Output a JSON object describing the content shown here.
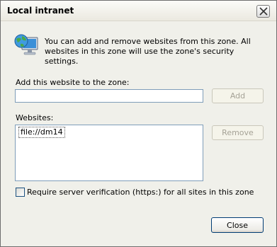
{
  "window": {
    "title": "Local intranet"
  },
  "info": {
    "icon": "intranet-computer-globe-icon",
    "text": "You can add and remove websites from this zone. All websites in this zone will use the zone's security settings."
  },
  "add_section": {
    "label": "Add this website to the zone:",
    "input_value": "",
    "add_button": "Add"
  },
  "websites_section": {
    "label": "Websites:",
    "items": [
      "file://dm14"
    ],
    "remove_button": "Remove"
  },
  "verification": {
    "checked": false,
    "label": "Require server verification (https:) for all sites in this zone"
  },
  "footer": {
    "close_button": "Close"
  }
}
